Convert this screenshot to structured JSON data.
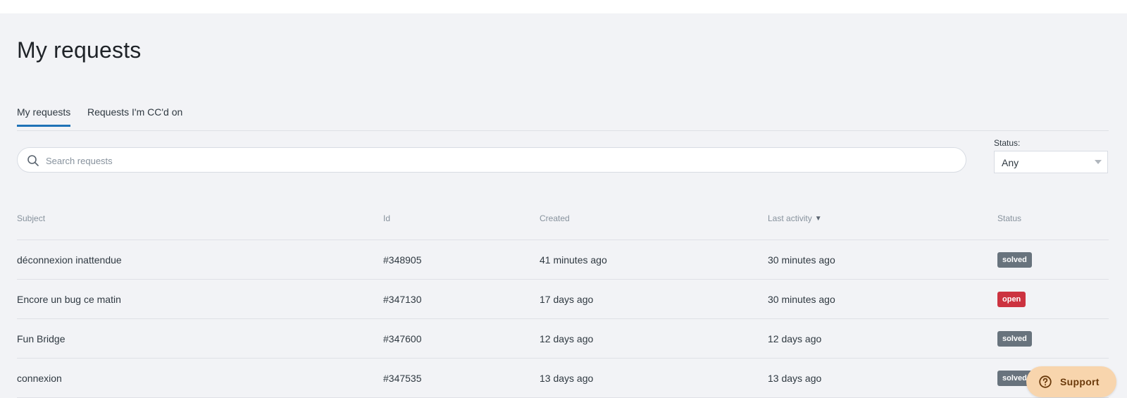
{
  "page": {
    "title": "My requests"
  },
  "tabs": [
    {
      "label": "My requests",
      "active": true
    },
    {
      "label": "Requests I'm CC'd on",
      "active": false
    }
  ],
  "search": {
    "placeholder": "Search requests",
    "value": "",
    "icon": "search-icon"
  },
  "status_filter": {
    "label": "Status:",
    "selected": "Any",
    "icon": "chevron-down-icon"
  },
  "table": {
    "columns": {
      "subject": "Subject",
      "id": "Id",
      "created": "Created",
      "last_activity": "Last activity",
      "status": "Status"
    },
    "sort_icon": "▼",
    "rows": [
      {
        "subject": "déconnexion inattendue",
        "id": "#348905",
        "created": "41 minutes ago",
        "last_activity": "30 minutes ago",
        "status": "solved"
      },
      {
        "subject": "Encore un bug ce matin",
        "id": "#347130",
        "created": "17 days ago",
        "last_activity": "30 minutes ago",
        "status": "open"
      },
      {
        "subject": "Fun Bridge",
        "id": "#347600",
        "created": "12 days ago",
        "last_activity": "12 days ago",
        "status": "solved"
      },
      {
        "subject": "connexion",
        "id": "#347535",
        "created": "13 days ago",
        "last_activity": "13 days ago",
        "status": "solved"
      }
    ]
  },
  "status_colors": {
    "solved": "#68737d",
    "open": "#cc3340"
  },
  "colors": {
    "accent": "#1f73b7",
    "support_bg": "#f8d5ad"
  },
  "support_button": {
    "label": "Support",
    "icon": "help-circle-icon"
  }
}
